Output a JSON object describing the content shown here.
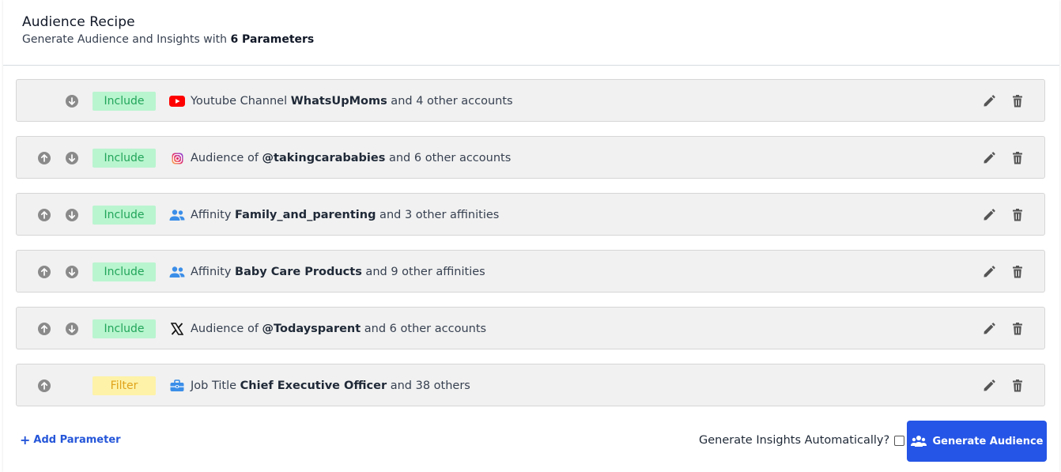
{
  "header": {
    "title": "Audience Recipe",
    "subtitle_prefix": "Generate Audience and Insights with ",
    "subtitle_bold": "6 Parameters"
  },
  "rows": [
    {
      "badge": "Include",
      "badge_type": "include",
      "icon": "youtube-icon",
      "prefix": "Youtube Channel ",
      "strong": "WhatsUpMoms",
      "suffix": " and 4 other accounts",
      "has_up": false,
      "has_down": true
    },
    {
      "badge": "Include",
      "badge_type": "include",
      "icon": "instagram-icon",
      "prefix": "Audience of ",
      "strong": "@takingcarababies",
      "suffix": " and 6 other accounts",
      "has_up": true,
      "has_down": true
    },
    {
      "badge": "Include",
      "badge_type": "include",
      "icon": "people-icon",
      "prefix": "Affinity ",
      "strong": "Family_and_parenting",
      "suffix": " and 3 other affinities",
      "has_up": true,
      "has_down": true
    },
    {
      "badge": "Include",
      "badge_type": "include",
      "icon": "people-icon",
      "prefix": "Affinity ",
      "strong": "Baby Care Products",
      "suffix": " and 9 other affinities",
      "has_up": true,
      "has_down": true
    },
    {
      "badge": "Include",
      "badge_type": "include",
      "icon": "x-icon",
      "prefix": "Audience of ",
      "strong": "@Todaysparent",
      "suffix": " and 6 other accounts",
      "has_up": true,
      "has_down": true
    },
    {
      "badge": "Filter",
      "badge_type": "filter",
      "icon": "briefcase-icon",
      "prefix": "Job Title ",
      "strong": "Chief Executive Officer",
      "suffix": " and 38 others",
      "has_up": true,
      "has_down": false
    }
  ],
  "footer": {
    "add_parameter_label": "Add Parameter",
    "auto_insights_label": "Generate Insights Automatically?",
    "auto_insights_checked": false,
    "generate_button_label": "Generate Audience"
  },
  "colors": {
    "accent": "#2555e6",
    "include_bg": "#b9f5cf",
    "include_text": "#22a55a",
    "filter_bg": "#fdf2a8",
    "filter_text": "#e0a31a"
  }
}
